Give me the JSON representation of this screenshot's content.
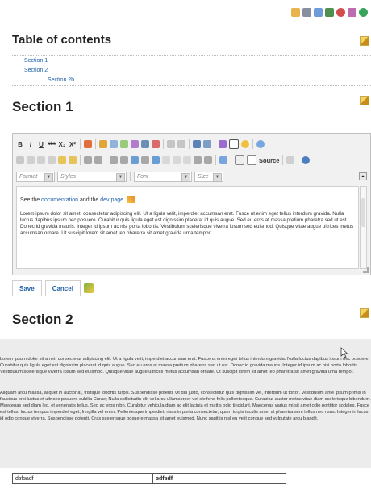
{
  "toc": {
    "title": "Table of contents",
    "items": [
      {
        "label": "Section 1"
      },
      {
        "label": "Section 2"
      },
      {
        "label": "Section 2b"
      }
    ]
  },
  "section1": {
    "title": "Section 1"
  },
  "editor": {
    "toolbar1": [
      "B",
      "I",
      "U",
      "abc",
      "X₂",
      "X²"
    ],
    "source_label": "Source",
    "format_combo": "Format",
    "styles_combo": "Styles",
    "font_combo": "Font",
    "size_combo": "Size",
    "intro_before": "See the ",
    "intro_link1": "documentation",
    "intro_mid": " and the ",
    "intro_link2": "dev page",
    "body": "Lorem ipsum dolor sit amet, consectetur adipiscing elit. Ut a ligula velit, imperdiet accumsan erat. Fusce ut enim eget tellus interdum gravida. Nulla luctus dapibus ipsum nec posuere. Curabitur quis ligula eget est dignissim placerat id quis augue. Sed eu eros at massa pretium pharetra sed ut est. Donec id gravida mauris. Integer id ipsum ac nisi porta lobortis. Vestibulum scelerisque viverra ipsum sed euismod. Quisque vitae augue ultrices metus accumsan ornare. Ut suscipit lorem sit amet leo pharetra sit amet gravida urna tempor."
  },
  "actions": {
    "save": "Save",
    "cancel": "Cancel"
  },
  "section2": {
    "title": "Section 2",
    "para1": "Lorem ipsum dolor sit amet, consectetur adipiscing elit. Ut a ligula velit, imperdiet accumsan erat. Fusce ut enim eget tellus interdum gravida. Nulla luctus dapibus ipsum nec posuere. Curabitur quis ligula eget est dignissim placerat id quis augue. Sed eu eros at massa pretium pharetra sed ut est. Donec id gravida mauris. Integer id ipsum ac nisi porta lobortis. Vestibulum scelerisque viverra ipsum sed euismod. Quisque vitae augue ultrices metus accumsan ornare. Ut suscipit lorem sit amet leo pharetra sit amet gravida urna tempor.",
    "para2": "Aliquam arcu massa, aliquet in auctor at, tristique lobortis turpis. Suspendisse potenti. Ut dui justo, consectetur quis dignissim vel, interdum ut tortor. Vestibulum ante ipsum primis in faucibus orci luctus et ultrices posuere cubilia Curae; Nulla sollicitudin elit vel arcu ullamcorper vel eleifend felis pellentesque. Curabitur auctor metus vitae diam scelerisque bibendum. Maecenas sed diam leo, et venenatis tellus. Sed ac eros nibh. Curabitur vehicula diam ac elit lacinia et mattis odio tincidunt. Maecenas varius mi sit amet odio porttitor sodales. Fusce est tellus, luctus tempus imperdiet eget, fringilla vel enim. Pellentesque imperdiet, risus in porta consectetur, quam turpis iaculis ante, at pharetra sem tellus nec risus. Integer in lacus id odio congue viverra. Suspendisse potenti. Cras scelerisque posuere massa sit amet euismod. Nunc sagittis nisl eu velit congue sed vulputate arcu blandit.",
    "table": [
      [
        "dsfsadf",
        "sdfsdf"
      ]
    ]
  },
  "colors": {
    "link": "#1f5fa8",
    "panel": "#ececec"
  }
}
